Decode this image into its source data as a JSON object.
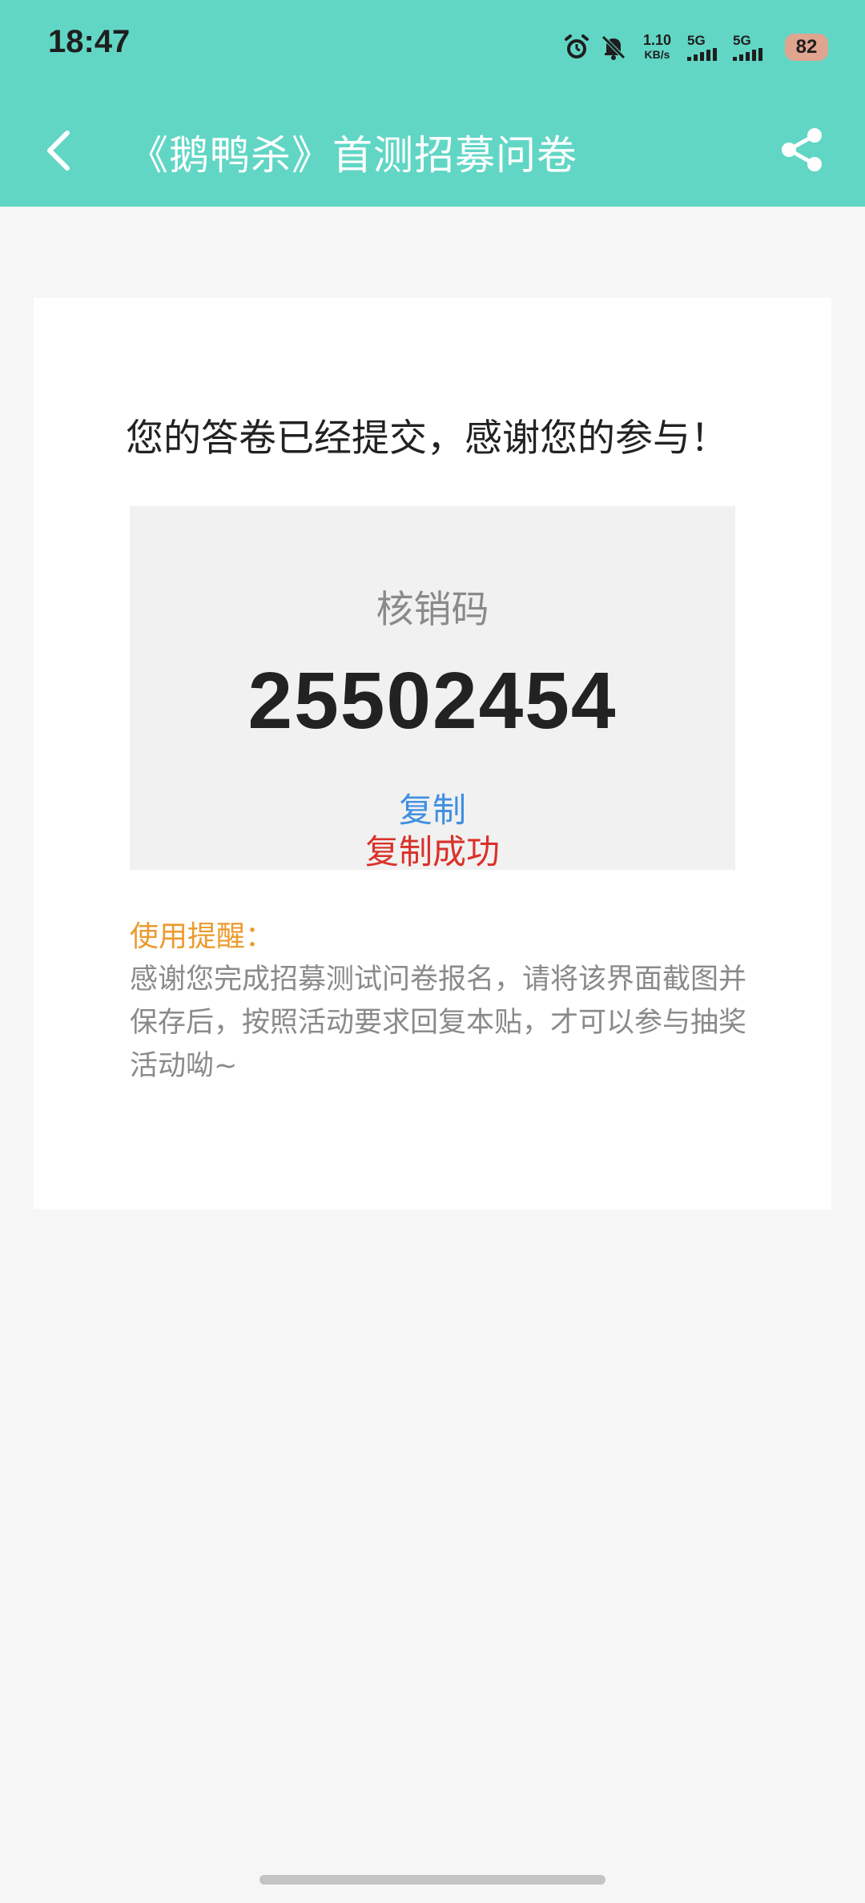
{
  "status_bar": {
    "time": "18:47",
    "net_speed_value": "1.10",
    "net_speed_unit": "KB/s",
    "sim1_label": "5G",
    "sim2_label": "5G",
    "battery_level": "82",
    "icons": [
      "alarm-icon",
      "bell-muted-icon"
    ]
  },
  "header": {
    "title": "《鹅鸭杀》首测招募问卷",
    "back_icon": "chevron-left-icon",
    "share_icon": "share-icon",
    "background_color": "#62d6c5"
  },
  "result": {
    "message": "您的答卷已经提交，感谢您的参与！",
    "code_label": "核销码",
    "code_value": "25502454",
    "copy_label": "复制",
    "copy_success_label": "复制成功"
  },
  "reminder": {
    "title": "使用提醒：",
    "text": "感谢您完成招募测试问卷报名，请将该界面截图并保存后，按照活动要求回复本贴，才可以参与抽奖活动呦~"
  },
  "colors": {
    "accent_teal": "#62d6c5",
    "link_blue": "#3f8fe0",
    "success_red": "#d9322a",
    "reminder_orange": "#eb9b2d"
  }
}
